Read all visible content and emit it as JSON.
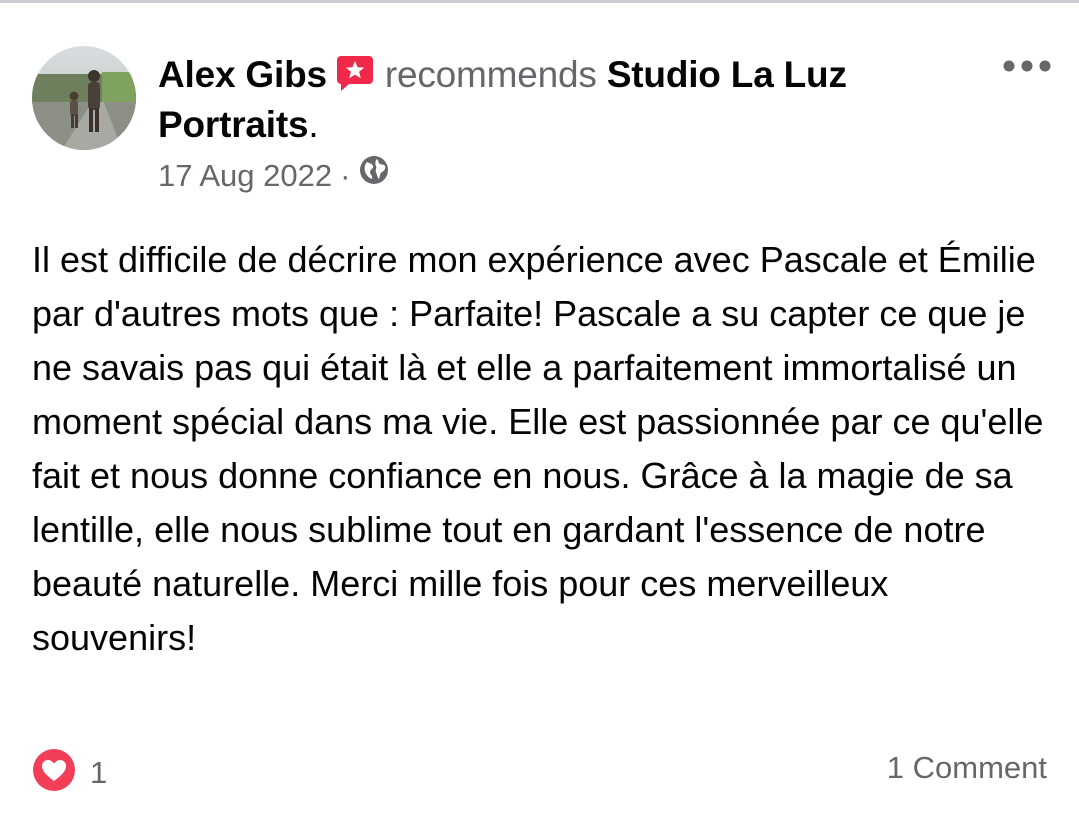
{
  "post": {
    "author": "Alex Gibs",
    "action": "recommends",
    "page_name": "Studio La Luz Portraits",
    "period": ".",
    "date": "17 Aug 2022",
    "separator": "·",
    "privacy_icon": "globe-icon",
    "recommend_icon": "recommend-flag-icon",
    "more_icon": "more-options-icon",
    "text": "Il est difficile de décrire mon expérience avec Pascale et Émilie par d'autres mots que : Parfaite! Pascale a su capter ce que je ne savais pas qui était là et elle a parfaitement immortalisé un moment spécial dans ma vie. Elle est passionnée par ce qu'elle fait et nous donne confiance en nous. Grâce à la magie de sa lentille, elle nous sublime tout en gardant l'essence de notre beauté naturelle. Merci mille fois pour ces merveilleux souvenirs!"
  },
  "reactions": {
    "icon": "love-reaction-icon",
    "count": "1"
  },
  "comments": {
    "label": "1 Comment"
  },
  "colors": {
    "text_primary": "#050505",
    "text_secondary": "#65676b",
    "love_red": "#f33e58",
    "recommend_red": "#f02849"
  }
}
